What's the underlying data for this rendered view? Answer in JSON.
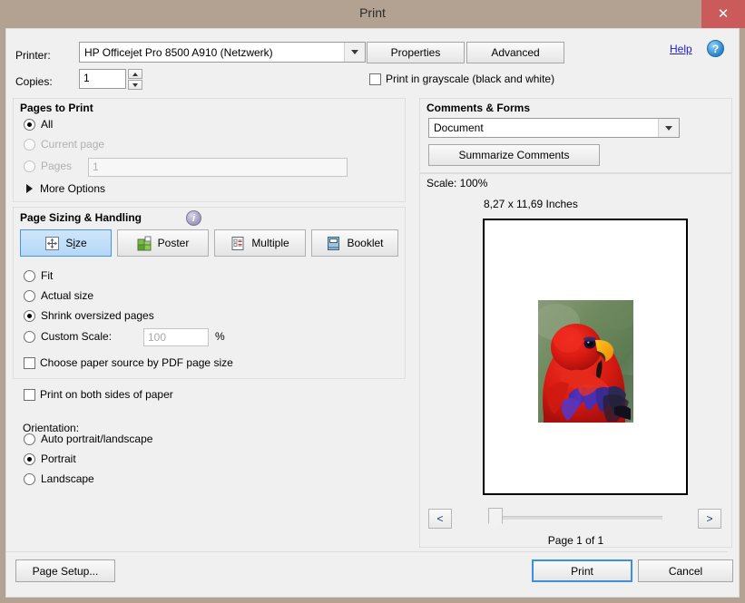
{
  "window": {
    "title": "Print",
    "close_label": "✕"
  },
  "printer": {
    "label": "Printer:",
    "selected": "HP Officejet Pro 8500 A910 (Netzwerk)",
    "properties_label": "Properties",
    "advanced_label": "Advanced",
    "help_label": "Help",
    "help_icon_glyph": "?"
  },
  "copies": {
    "label": "Copies:",
    "value": "1"
  },
  "grayscale": {
    "label": "Print in grayscale (black and white)",
    "checked": false
  },
  "pages_to_print": {
    "title": "Pages to Print",
    "options": [
      {
        "label": "All",
        "selected": true,
        "disabled": false
      },
      {
        "label": "Current page",
        "selected": false,
        "disabled": true
      },
      {
        "label": "Pages",
        "selected": false,
        "disabled": true
      }
    ],
    "pages_value": "1",
    "more_options_label": "More Options"
  },
  "page_sizing": {
    "title": "Page Sizing & Handling",
    "info_glyph": "i",
    "tabs": [
      {
        "label": "Size",
        "selected": true,
        "icon": "size-icon"
      },
      {
        "label": "Poster",
        "selected": false,
        "icon": "poster-icon"
      },
      {
        "label": "Multiple",
        "selected": false,
        "icon": "multiple-icon"
      },
      {
        "label": "Booklet",
        "selected": false,
        "icon": "booklet-icon"
      }
    ],
    "scale_options": [
      {
        "label": "Fit",
        "selected": false
      },
      {
        "label": "Actual size",
        "selected": false
      },
      {
        "label": "Shrink oversized pages",
        "selected": true
      },
      {
        "label": "Custom Scale:",
        "selected": false
      }
    ],
    "custom_scale_value": "100",
    "percent_label": "%",
    "paper_source_label": "Choose paper source by PDF page size",
    "paper_source_checked": false
  },
  "duplex": {
    "label": "Print on both sides of paper",
    "checked": false
  },
  "orientation": {
    "title": "Orientation:",
    "options": [
      {
        "label": "Auto portrait/landscape",
        "selected": false
      },
      {
        "label": "Portrait",
        "selected": true
      },
      {
        "label": "Landscape",
        "selected": false
      }
    ]
  },
  "comments_forms": {
    "title": "Comments & Forms",
    "selected": "Document",
    "summarize_label": "Summarize Comments"
  },
  "preview": {
    "scale_label": "Scale: 100%",
    "dimensions_label": "8,27 x 11,69 Inches",
    "prev_label": "<",
    "next_label": ">",
    "page_label": "Page 1 of 1",
    "image_alt": "red-lory-parrot-photo"
  },
  "footer": {
    "page_setup_label": "Page Setup...",
    "print_label": "Print",
    "cancel_label": "Cancel"
  },
  "colors": {
    "title_bar": "#b3a292",
    "close_button": "#cb5b5a",
    "accent_blue": "#3c8ede",
    "selected_tab": "#b4d8f7",
    "link_blue": "#2020d0"
  }
}
